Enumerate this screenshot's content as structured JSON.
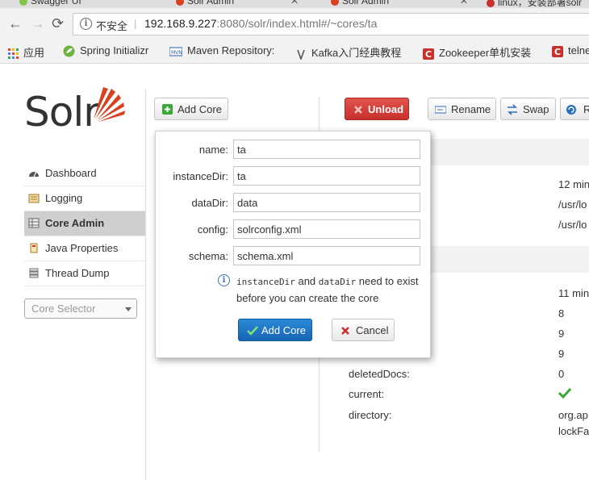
{
  "browser": {
    "tabs": [
      {
        "label": "Swagger UI",
        "favicon_color": "#85c446"
      },
      {
        "label": "Solr Admin",
        "favicon_color": "#d9411e"
      },
      {
        "label": "Solr Admin",
        "favicon_color": "#d9411e"
      },
      {
        "label": "linux，安装部署solr",
        "favicon_color": "#c9302c"
      }
    ],
    "address": {
      "security_label": "不安全",
      "host": "192.168.9.227",
      "rest": ":8080/solr/index.html#/~cores/ta"
    },
    "bookmarks": [
      {
        "label": "应用",
        "icon": "apps-grid-icon"
      },
      {
        "label": "Spring Initializr",
        "icon": "spring-icon"
      },
      {
        "label": "Maven Repository:",
        "icon": "mvn-icon"
      },
      {
        "label": "Kafka入门经典教程",
        "icon": "kafka-icon"
      },
      {
        "label": "Zookeeper单机安装",
        "icon": "csdn-icon"
      },
      {
        "label": "telne",
        "icon": "csdn-icon"
      }
    ]
  },
  "sidebar": {
    "logo_text": "Solr",
    "items": [
      {
        "label": "Dashboard",
        "active": false
      },
      {
        "label": "Logging",
        "active": false
      },
      {
        "label": "Core Admin",
        "active": true
      },
      {
        "label": "Java Properties",
        "active": false
      },
      {
        "label": "Thread Dump",
        "active": false
      }
    ],
    "core_selector_placeholder": "Core Selector"
  },
  "toolbar": {
    "add_core": "Add Core",
    "unload": "Unload",
    "rename": "Rename",
    "swap": "Swap",
    "reload_partial": "R"
  },
  "details": {
    "rows_top": [
      "12 min",
      "/usr/lo",
      "/usr/lo"
    ],
    "rows_index": [
      "11 min",
      "8",
      "9",
      "9"
    ],
    "deleted_docs_label": "deletedDocs:",
    "deleted_docs_value": "0",
    "current_label": "current:",
    "directory_label": "directory:",
    "directory_value_1": "org.ap",
    "directory_value_2": "lockFa"
  },
  "popup": {
    "fields": [
      {
        "label": "name:",
        "value": "ta"
      },
      {
        "label": "instanceDir:",
        "value": "ta"
      },
      {
        "label": "dataDir:",
        "value": "data"
      },
      {
        "label": "config:",
        "value": "solrconfig.xml"
      },
      {
        "label": "schema:",
        "value": "schema.xml"
      }
    ],
    "note_code1": "instanceDir",
    "note_and": " and ",
    "note_code2": "dataDir",
    "note_tail": " need to exist before you can create the core",
    "add_button": "Add Core",
    "cancel_button": "Cancel"
  },
  "colors": {
    "unload": "#c9302c",
    "primary": "#1565b5",
    "check": "#3aa835",
    "solr_orange": "#d9411e"
  }
}
